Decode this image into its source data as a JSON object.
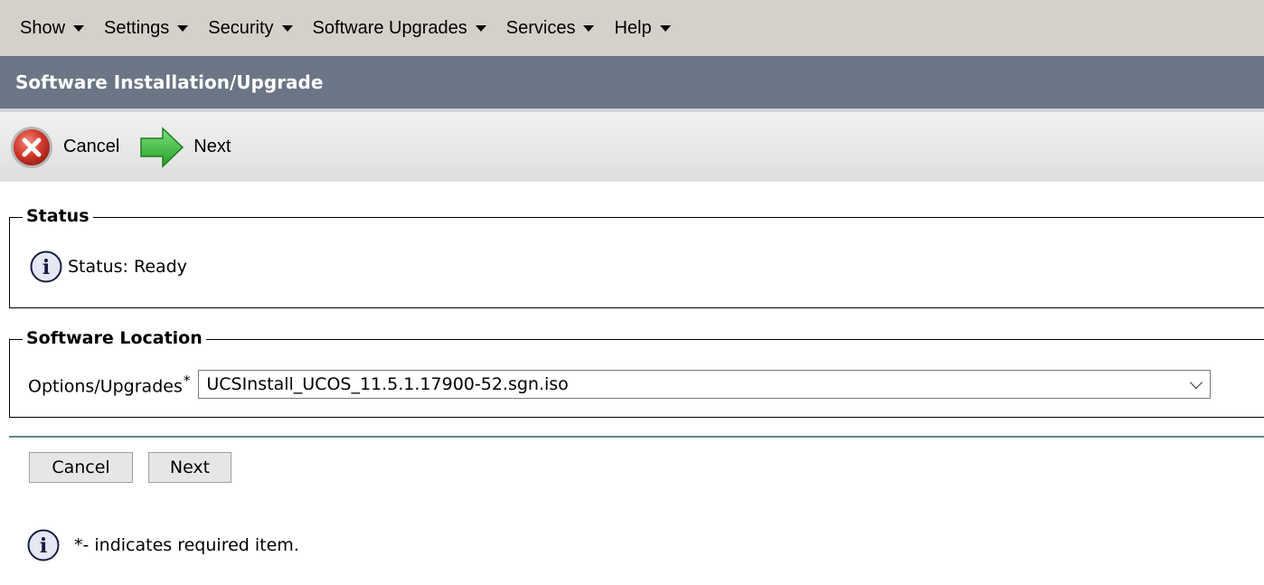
{
  "menu": {
    "items": [
      {
        "label": "Show"
      },
      {
        "label": "Settings"
      },
      {
        "label": "Security"
      },
      {
        "label": "Software Upgrades"
      },
      {
        "label": "Services"
      },
      {
        "label": "Help"
      }
    ]
  },
  "page": {
    "title": "Software Installation/Upgrade"
  },
  "toolbar": {
    "cancel_label": "Cancel",
    "next_label": "Next"
  },
  "status_section": {
    "legend": "Status",
    "status_text": "Status: Ready",
    "icon": "info-icon"
  },
  "location_section": {
    "legend": "Software Location",
    "field_label": "Options/Upgrades",
    "required_marker": "*",
    "selected_value": "UCSInstall_UCOS_11.5.1.17900-52.sgn.iso"
  },
  "bottom_buttons": {
    "cancel_label": "Cancel",
    "next_label": "Next"
  },
  "footnote": {
    "text": "*- indicates required item.",
    "icon": "info-icon"
  },
  "colors": {
    "menubar_bg": "#d5d1ca",
    "titlebar_bg": "#6b7585",
    "cancel_icon_red": "#c0392b",
    "next_icon_green": "#3cb83c",
    "divider": "#5c8a8a"
  }
}
